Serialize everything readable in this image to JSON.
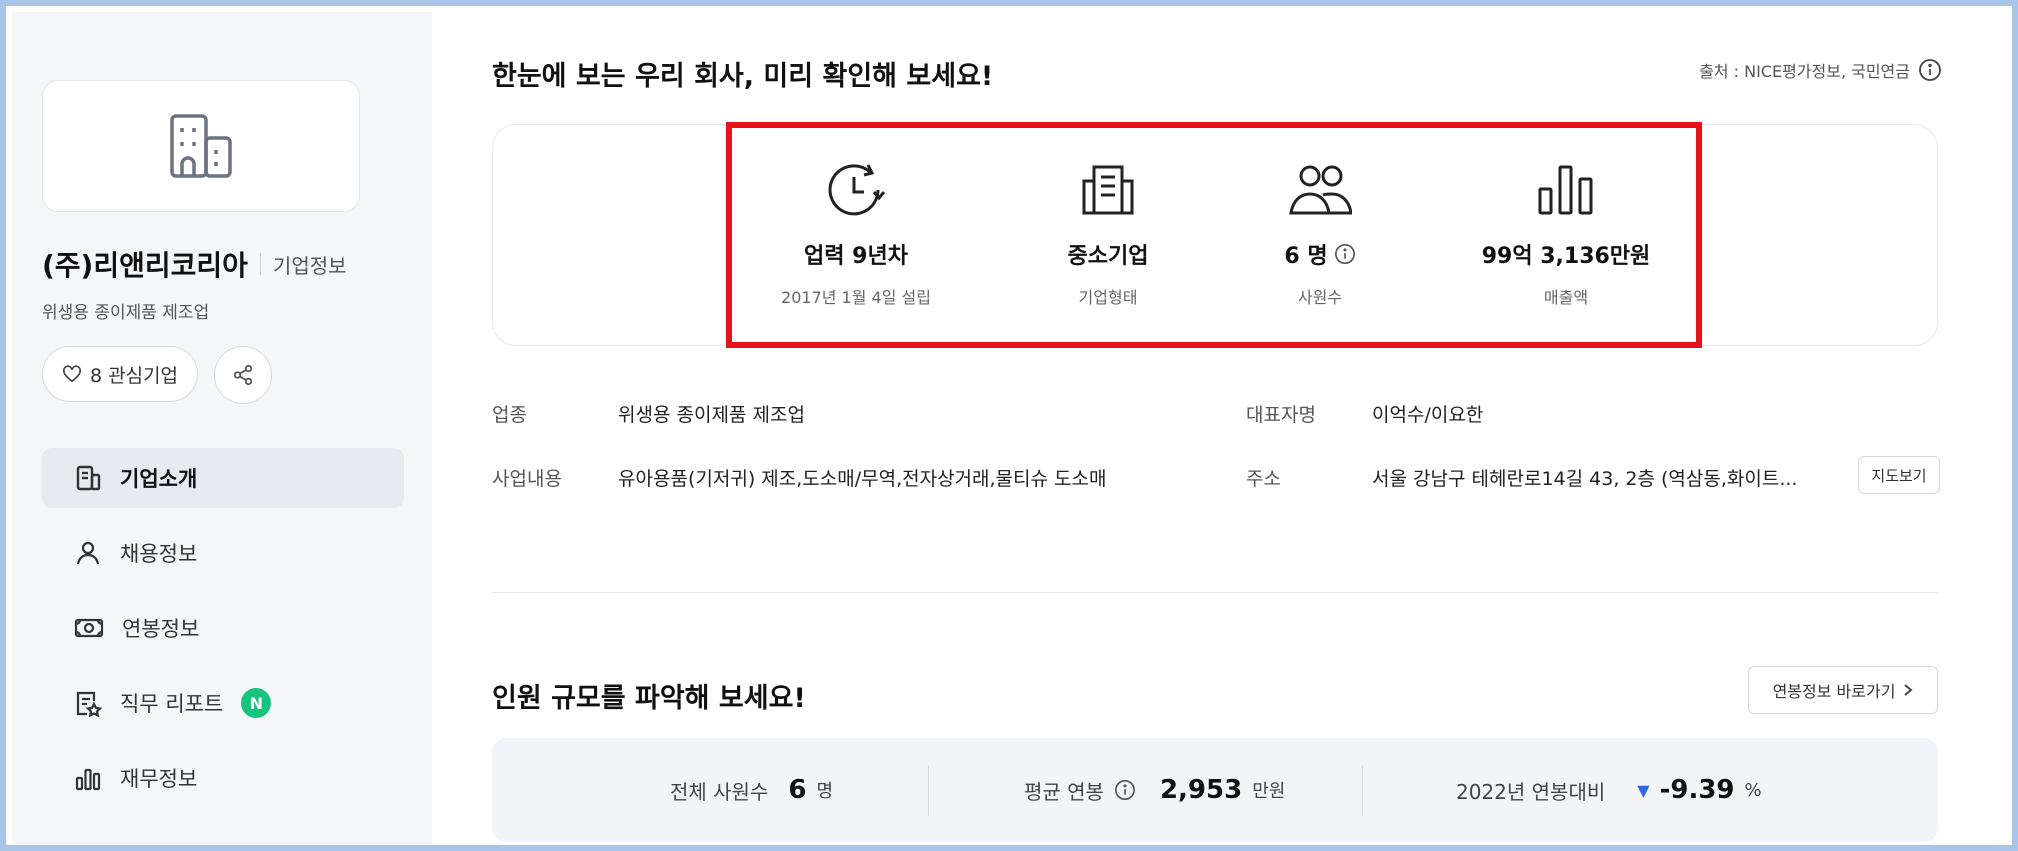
{
  "sidebar": {
    "company_name": "(주)리앤리코리아",
    "company_info_label": "기업정보",
    "industry": "위생용 종이제품 제조업",
    "follow_label": "8 관심기업",
    "nav": [
      {
        "label": "기업소개",
        "icon": "company-intro-icon",
        "active": true
      },
      {
        "label": "채용정보",
        "icon": "person-icon"
      },
      {
        "label": "연봉정보",
        "icon": "money-icon"
      },
      {
        "label": "직무 리포트",
        "icon": "report-star-icon",
        "badge": "N"
      },
      {
        "label": "재무정보",
        "icon": "bar-chart-icon"
      }
    ]
  },
  "main": {
    "title": "한눈에 보는 우리 회사, 미리 확인해 보세요!",
    "source": "출처 : NICE평가정보, 국민연금",
    "stats": [
      {
        "icon": "clock-history-icon",
        "value": "업력 9년차",
        "label": "2017년 1월 4일 설립"
      },
      {
        "icon": "building-icon",
        "value": "중소기업",
        "label": "기업형태"
      },
      {
        "icon": "people-icon",
        "value": "6 명",
        "label": "사원수"
      },
      {
        "icon": "bar-chart-icon",
        "value": "99억 3,136만원",
        "label": "매출액"
      }
    ],
    "details": {
      "industry_label": "업종",
      "industry_value": "위생용 종이제품 제조업",
      "ceo_label": "대표자명",
      "ceo_value": "이억수/이요한",
      "business_label": "사업내용",
      "business_value": "유아용품(기저귀) 제조,도소매/무역,전자상거래,물티슈 도소매",
      "address_label": "주소",
      "address_value": "서울 강남구 테헤란로14길 43, 2층 (역삼동,화이트...",
      "map_button": "지도보기"
    },
    "headcount_title": "인원 규모를 파악해 보세요!",
    "salary_link": "연봉정보 바로가기",
    "summary": {
      "employees_label": "전체 사원수",
      "employees_value": "6",
      "employees_unit": "명",
      "avg_salary_label": "평균 연봉",
      "avg_salary_value": "2,953",
      "avg_salary_unit": "만원",
      "compare_label": "2022년 연봉대비",
      "compare_value": "-9.39",
      "compare_unit": "%"
    }
  },
  "colors": {
    "highlight": "#e8121a",
    "badge": "#18c37d",
    "down": "#2f66e0",
    "sidebar_bg": "#f5f6f8"
  }
}
